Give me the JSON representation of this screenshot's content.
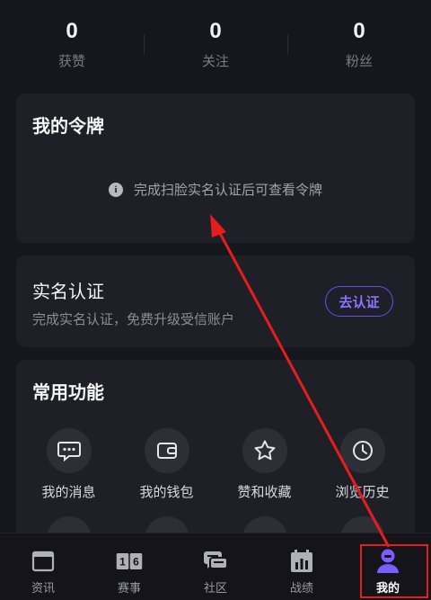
{
  "stats": [
    {
      "value": "0",
      "label": "获赞"
    },
    {
      "value": "0",
      "label": "关注"
    },
    {
      "value": "0",
      "label": "粉丝"
    }
  ],
  "token_card": {
    "title": "我的令牌",
    "tip_icon": "info-icon",
    "tip": "完成扫脸实名认证后可查看令牌"
  },
  "real_name": {
    "title": "实名认证",
    "desc": "完成实名认证，免费升级受信账户",
    "button": "去认证",
    "accent": "#6a4cf0"
  },
  "functions": {
    "title": "常用功能",
    "items": [
      {
        "label": "我的消息",
        "icon": "message-icon"
      },
      {
        "label": "我的钱包",
        "icon": "wallet-icon"
      },
      {
        "label": "赞和收藏",
        "icon": "star-icon"
      },
      {
        "label": "浏览历史",
        "icon": "clock-icon"
      }
    ]
  },
  "tabbar": {
    "items": [
      {
        "label": "资讯",
        "icon": "news-icon"
      },
      {
        "label": "赛事",
        "icon": "score-icon",
        "icon_text": "1 6"
      },
      {
        "label": "社区",
        "icon": "chat-icon"
      },
      {
        "label": "战绩",
        "icon": "stats-icon"
      },
      {
        "label": "我的",
        "icon": "user-icon",
        "active": true
      }
    ]
  },
  "annotation_color": "#e51d1d"
}
